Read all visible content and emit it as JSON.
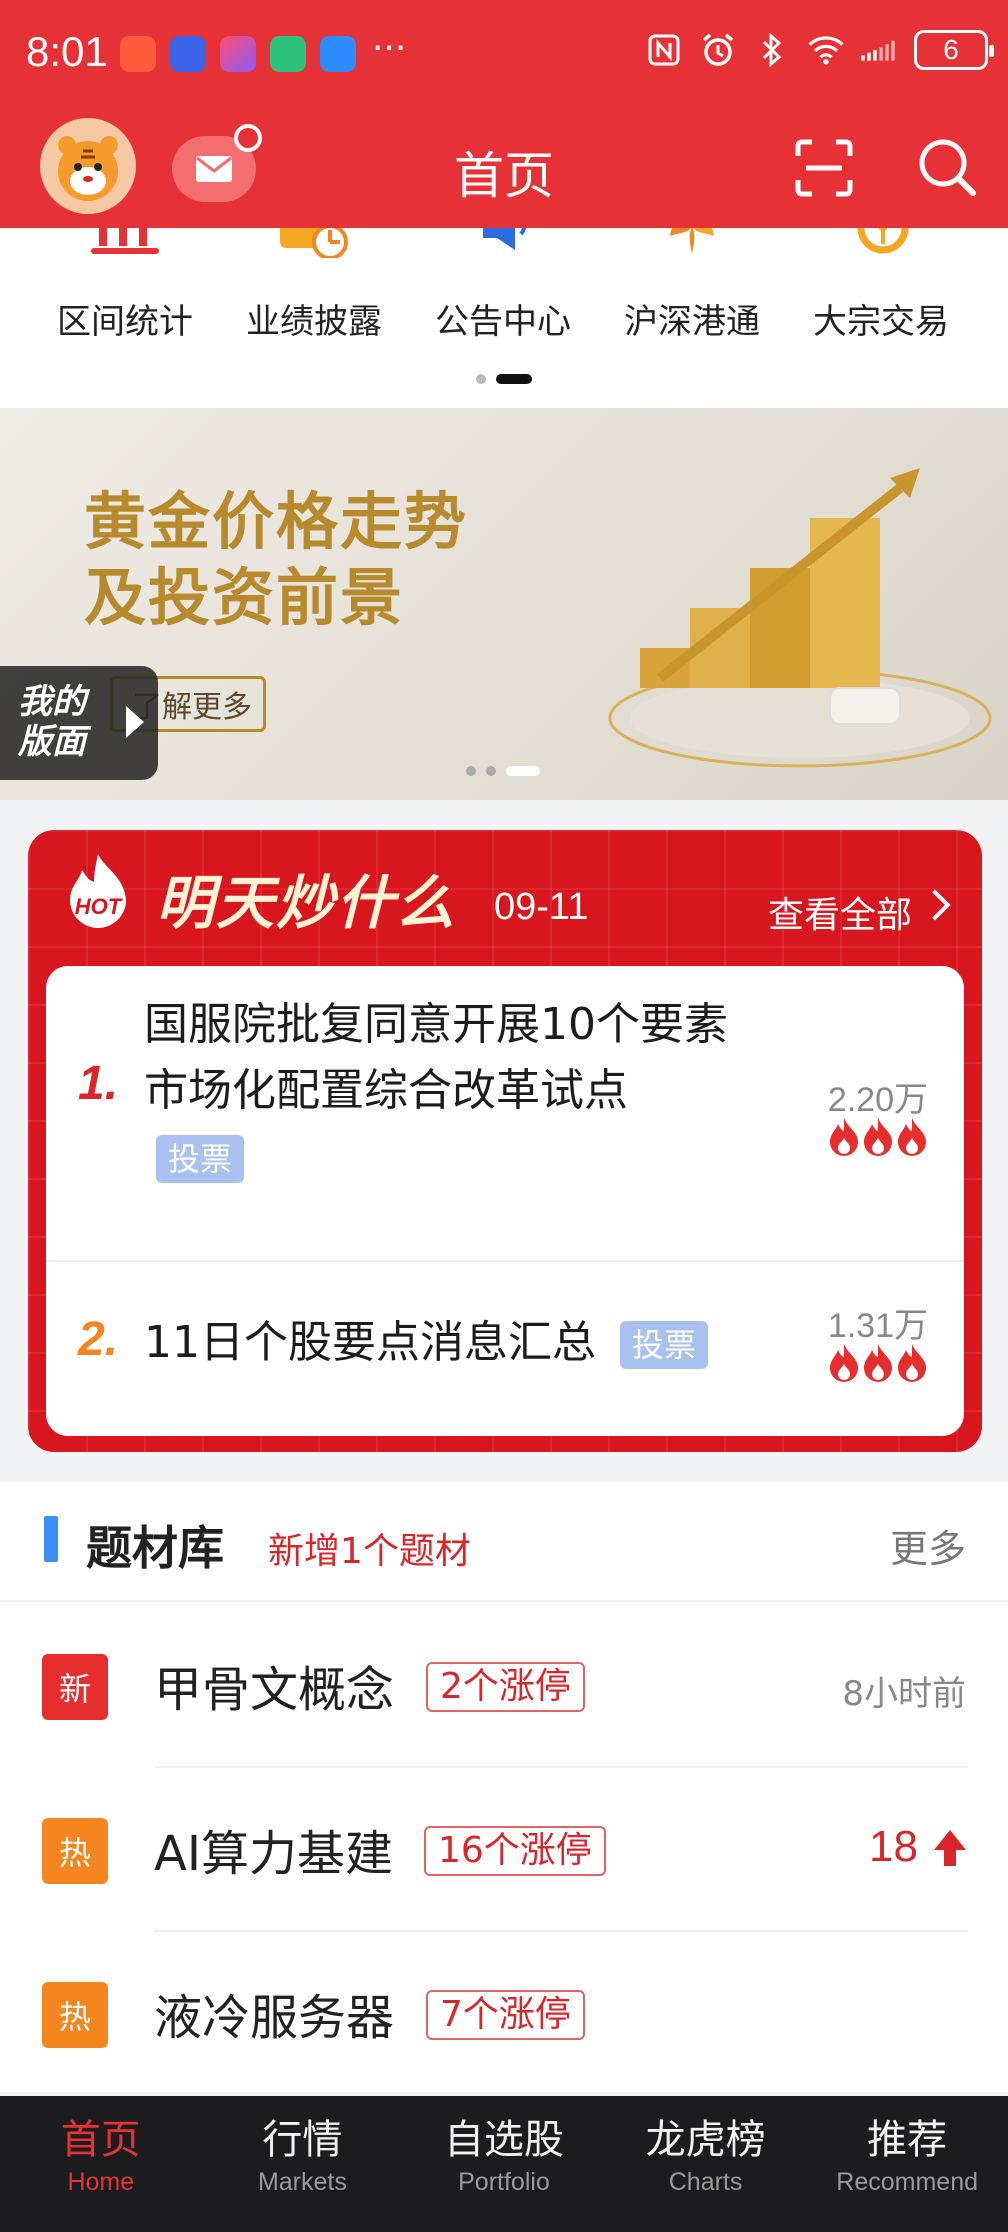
{
  "status_bar": {
    "time": "8:01",
    "more": "···",
    "battery": "6"
  },
  "header": {
    "title": "首页"
  },
  "quick_menu": {
    "items": [
      {
        "label": "区间统计",
        "icon": "chart-stats-icon"
      },
      {
        "label": "业绩披露",
        "icon": "report-icon"
      },
      {
        "label": "公告中心",
        "icon": "megaphone-icon"
      },
      {
        "label": "沪深港通",
        "icon": "connect-icon"
      },
      {
        "label": "大宗交易",
        "icon": "bulk-trade-icon"
      }
    ]
  },
  "banner": {
    "title_line1": "黄金价格走势",
    "title_line2": "及投资前景",
    "cta": "了解更多"
  },
  "my_layout": {
    "line1": "我的",
    "line2": "版面"
  },
  "hot": {
    "logo_text": "HOT",
    "title": "明天炒什么",
    "date": "09-11",
    "view_all": "查看全部",
    "items": [
      {
        "rank": "1.",
        "text": "国服院批复同意开展10个要素市场化配置综合改革试点",
        "tag": "投票",
        "count": "2.20万"
      },
      {
        "rank": "2.",
        "text": "11日个股要点消息汇总",
        "tag": "投票",
        "count": "1.31万"
      }
    ]
  },
  "topics": {
    "title": "题材库",
    "new_note": "新增1个题材",
    "more": "更多",
    "rows": [
      {
        "badge": "新",
        "name": "甲骨文概念",
        "limit_up": "2个涨停",
        "meta": "8小时前"
      },
      {
        "badge": "热",
        "name": "AI算力基建",
        "limit_up": "16个涨停",
        "meta": "18"
      },
      {
        "badge": "热",
        "name": "液冷服务器",
        "limit_up": "7个涨停",
        "meta": ""
      }
    ]
  },
  "tabbar": {
    "tabs": [
      {
        "cn": "首页",
        "en": "Home"
      },
      {
        "cn": "行情",
        "en": "Markets"
      },
      {
        "cn": "自选股",
        "en": "Portfolio"
      },
      {
        "cn": "龙虎榜",
        "en": "Charts"
      },
      {
        "cn": "推荐",
        "en": "Recommend"
      }
    ]
  },
  "colors": {
    "brand_red": "#e63236",
    "hot_red": "#d8161d",
    "accent_blue": "#3c8ff5",
    "tag_blue": "#a9c1ee",
    "hot_orange": "#f5861f"
  }
}
